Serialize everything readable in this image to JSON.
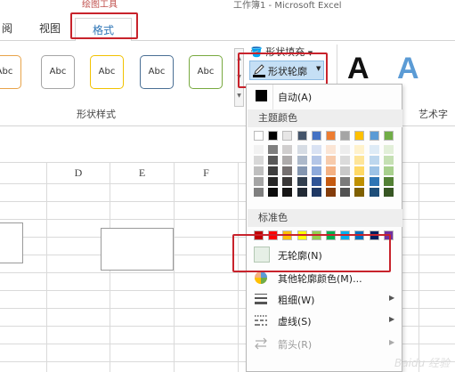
{
  "window": {
    "title": "工作簿1 - Microsoft Excel",
    "context_tools": "绘图工具"
  },
  "tabs": [
    {
      "label": "阅"
    },
    {
      "label": "视图"
    },
    {
      "label": "格式"
    }
  ],
  "ribbon": {
    "style_sample": "Abc",
    "style_samples": [
      {
        "border": "#e8a34a"
      },
      {
        "border": "#a5a5a5"
      },
      {
        "border": "#f2c200"
      },
      {
        "border": "#4a6f94"
      },
      {
        "border": "#78a93f"
      }
    ],
    "shape_styles_label": "形状样式",
    "fill_label": "形状填充",
    "outline_label": "形状轮廓",
    "wordart_letter": "A",
    "wordart_label": "艺术字",
    "wordart_colors": [
      "#111111",
      "#5b9bd5"
    ]
  },
  "sheet": {
    "columns": [
      "D",
      "E",
      "F"
    ]
  },
  "menu": {
    "auto_label": "自动(A)",
    "theme_colors_label": "主题颜色",
    "standard_colors_label": "标准色",
    "no_outline_label": "无轮廓(N)",
    "more_colors_label": "其他轮廓颜色(M)...",
    "weight_label": "粗细(W)",
    "dashes_label": "虚线(S)",
    "arrows_label": "箭头(R)",
    "theme_base": [
      "#ffffff",
      "#000000",
      "#e7e6e6",
      "#44546a",
      "#4472c4",
      "#ed7d31",
      "#a5a5a5",
      "#ffc000",
      "#5b9bd5",
      "#70ad47"
    ],
    "theme_tints": [
      [
        "#f2f2f2",
        "#7f7f7f",
        "#d0cece",
        "#d6dce4",
        "#d9e2f3",
        "#fbe5d5",
        "#ededed",
        "#fff2cc",
        "#deebf6",
        "#e2efd9"
      ],
      [
        "#d8d8d8",
        "#595959",
        "#aeabab",
        "#adb9ca",
        "#b4c6e7",
        "#f7cbac",
        "#dbdbdb",
        "#fee599",
        "#bdd7ee",
        "#c5e0b3"
      ],
      [
        "#bfbfbf",
        "#3f3f3f",
        "#757070",
        "#8496b0",
        "#8eaadb",
        "#f4b183",
        "#c9c9c9",
        "#ffd965",
        "#9dc3e6",
        "#a8d08d"
      ],
      [
        "#a5a5a5",
        "#262626",
        "#3a3838",
        "#323f4f",
        "#2f5496",
        "#c55a11",
        "#7b7b7b",
        "#bf9000",
        "#2e75b5",
        "#538135"
      ],
      [
        "#7f7f7f",
        "#0c0c0c",
        "#171616",
        "#222a35",
        "#1f3864",
        "#833c0b",
        "#525252",
        "#7f6000",
        "#1e4e79",
        "#375623"
      ]
    ],
    "standard": [
      "#c00000",
      "#ff0000",
      "#ffc000",
      "#ffff00",
      "#92d050",
      "#00b050",
      "#00b0f0",
      "#0070c0",
      "#002060",
      "#7030a0"
    ]
  },
  "watermark": "Baidu 经验"
}
